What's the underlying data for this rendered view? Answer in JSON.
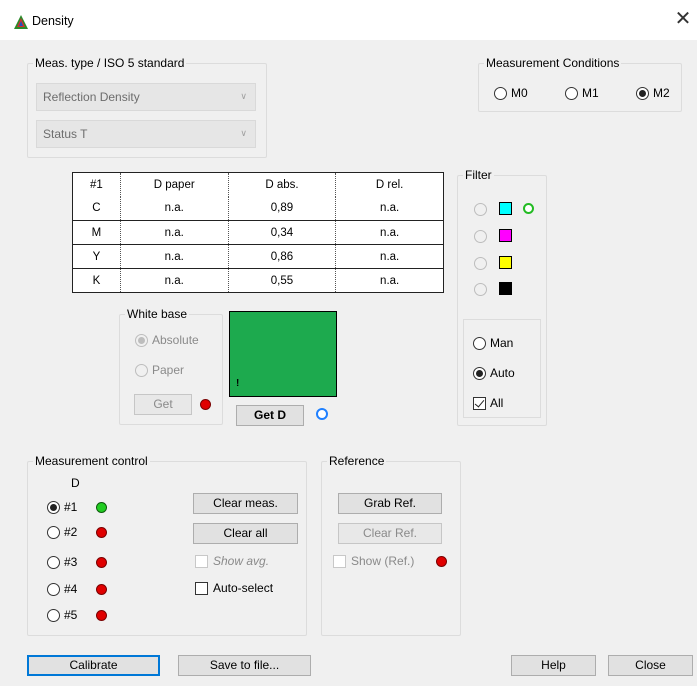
{
  "window": {
    "title": "Density",
    "close_glyph": "✕",
    "icon": "density-app-icon"
  },
  "meas_type": {
    "legend": "Meas. type / ISO 5 standard",
    "type_value": "Reflection Density",
    "status_value": "Status T"
  },
  "meas_conditions": {
    "legend": "Measurement Conditions",
    "options": [
      "M0",
      "M1",
      "M2"
    ],
    "selected": "M2"
  },
  "table": {
    "headers": [
      "#1",
      "D paper",
      "D abs.",
      "D rel."
    ],
    "rows": [
      [
        "C",
        "n.a.",
        "0,89",
        "n.a."
      ],
      [
        "M",
        "n.a.",
        "0,34",
        "n.a."
      ],
      [
        "Y",
        "n.a.",
        "0,86",
        "n.a."
      ],
      [
        "K",
        "n.a.",
        "0,55",
        "n.a."
      ]
    ]
  },
  "filter": {
    "legend": "Filter",
    "swatch_colors": [
      "#00ffff",
      "#ff00ff",
      "#ffff00",
      "#000000"
    ],
    "modes": [
      "Man",
      "Auto"
    ],
    "selected_mode": "Auto",
    "all_label": "All",
    "all_checked": true
  },
  "white_base": {
    "legend": "White base",
    "options": [
      "Absolute",
      "Paper"
    ],
    "selected": "Absolute",
    "get_label": "Get"
  },
  "preview": {
    "color": "#1daa4e",
    "marker": "!",
    "get_d_label": "Get D"
  },
  "meas_control": {
    "legend": "Measurement control",
    "column_label": "D",
    "slots": [
      "#1",
      "#2",
      "#3",
      "#4",
      "#5"
    ],
    "selected": "#1",
    "clear_meas": "Clear meas.",
    "clear_all": "Clear all",
    "show_avg": "Show avg.",
    "auto_select": "Auto-select"
  },
  "reference": {
    "legend": "Reference",
    "grab_ref": "Grab Ref.",
    "clear_ref": "Clear Ref.",
    "show_ref": "Show (Ref.)"
  },
  "footer": {
    "calibrate": "Calibrate",
    "save": "Save to file...",
    "help": "Help",
    "close": "Close"
  },
  "colors": {
    "status_red": "#e00000",
    "status_green": "#22cc22",
    "focus_blue": "#0078d7"
  }
}
